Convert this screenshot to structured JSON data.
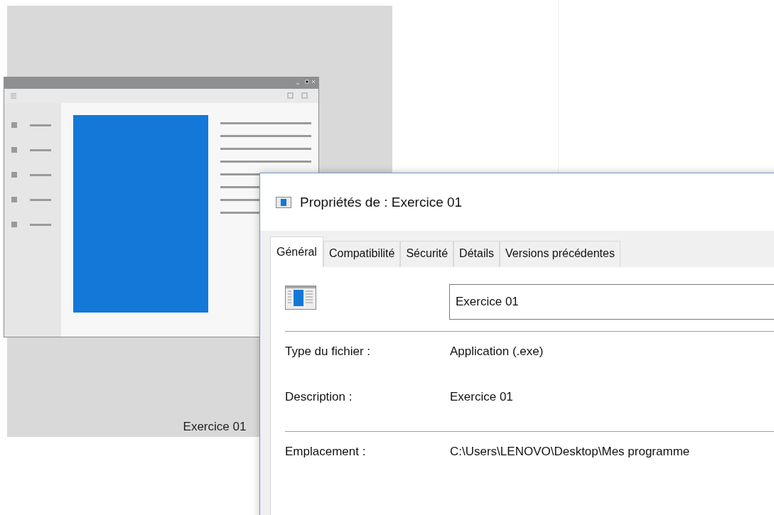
{
  "desktop_item": {
    "label": "Exercice 01",
    "selected": true
  },
  "dialog": {
    "title": "Propriétés de : Exercice 01",
    "tabs": [
      {
        "label": "Général",
        "selected": true
      },
      {
        "label": "Compatibilité",
        "selected": false
      },
      {
        "label": "Sécurité",
        "selected": false
      },
      {
        "label": "Détails",
        "selected": false
      },
      {
        "label": "Versions précédentes",
        "selected": false
      }
    ],
    "name_field": {
      "value": "Exercice 01"
    },
    "groups": [
      [
        {
          "label": "Type du fichier :",
          "value": "Application (.exe)"
        },
        {
          "label": "Description :",
          "value": "Exercice 01"
        }
      ],
      [
        {
          "label": "Emplacement :",
          "value": "C:\\Users\\LENOVO\\Desktop\\Mes programme"
        }
      ]
    ]
  }
}
